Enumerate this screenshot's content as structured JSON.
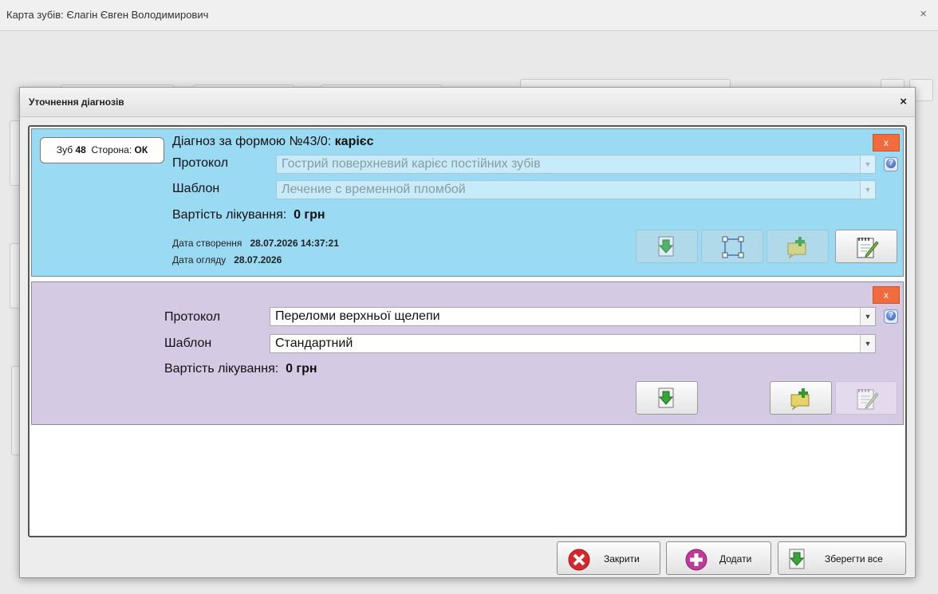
{
  "window": {
    "title": "Карта зубів: Єлагін Євген Володимирович",
    "close_glyph": "×"
  },
  "dialog": {
    "title": "Уточнення діагнозів",
    "close_glyph": "×"
  },
  "card1": {
    "tooth_label": "Зуб",
    "tooth_number": "48",
    "side_label": "Сторона:",
    "side_value": "ОК",
    "diagnosis_prefix": "Діагноз за формою №43/0:",
    "diagnosis_value": "карієс",
    "protocol_label": "Протокол",
    "protocol_value": "Гострий поверхневий карієс постійних зубів",
    "template_label": "Шаблон",
    "template_value": "Лечение с временной пломбой",
    "cost_label": "Вартість лікування:",
    "cost_value": "0 грн",
    "created_label": "Дата створення",
    "created_value": "28.07.2026 14:37:21",
    "exam_label": "Дата огляду",
    "exam_value": "28.07.2026",
    "remove_label": "x"
  },
  "card2": {
    "protocol_label": "Протокол",
    "protocol_value": "Переломи верхньої щелепи",
    "template_label": "Шаблон",
    "template_value": "Стандартний",
    "cost_label": "Вартість лікування:",
    "cost_value": "0 грн",
    "remove_label": "x"
  },
  "footer": {
    "close_label": "Закрити",
    "add_label": "Додати",
    "save_all_label": "Зберегти все"
  },
  "colors": {
    "card1_bg": "#9bdaf3",
    "card2_bg": "#d4cae4",
    "remove_button": "#f06c3c"
  }
}
